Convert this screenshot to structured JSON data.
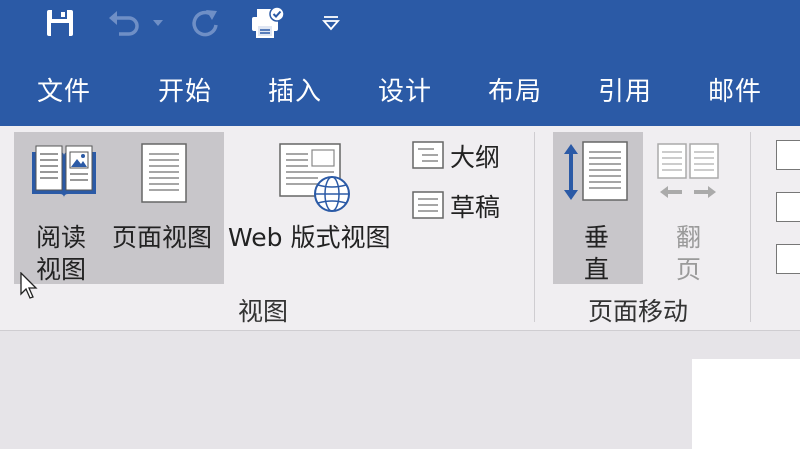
{
  "qat": {
    "icons": [
      "save-icon",
      "undo-icon",
      "undo-dropdown-icon",
      "redo-icon",
      "print-preview-icon",
      "customize-qat-icon"
    ]
  },
  "tabs": [
    {
      "label": "文件"
    },
    {
      "label": "开始"
    },
    {
      "label": "插入"
    },
    {
      "label": "设计"
    },
    {
      "label": "布局"
    },
    {
      "label": "引用"
    },
    {
      "label": "邮件"
    }
  ],
  "ribbon": {
    "views": {
      "read_mode_line1": "阅读",
      "read_mode_line2": "视图",
      "page_view": "页面视图",
      "web_view": "Web 版式视图",
      "outline": "大纲",
      "draft": "草稿",
      "group_label": "视图"
    },
    "page_move": {
      "vertical_line1": "垂",
      "vertical_line2": "直",
      "side_line1": "翻",
      "side_line2": "页",
      "group_label": "页面移动"
    }
  },
  "colors": {
    "title_bar": "#2b5aa6",
    "ribbon_bg": "#f0eef1",
    "selected_bg": "#c8c6ca",
    "accent_blue": "#2b5aa6"
  }
}
